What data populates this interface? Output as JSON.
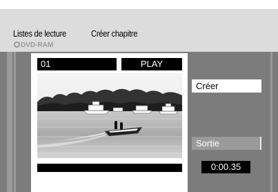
{
  "header": {
    "playlists_label": "Listes de lecture",
    "create_chapter_label": "Créer chapitre",
    "media_label": "DVD-RAM"
  },
  "player": {
    "title_number": "01",
    "status": "PLAY",
    "timecode": "0:00.35",
    "scene": "motorboat-on-lake-photo"
  },
  "actions": {
    "create_label": "Créer",
    "exit_label": "Sortie"
  },
  "colors": {
    "background": "#7c7c7c",
    "header": "#dcdcdc",
    "rail": "#9a9a9a",
    "highlight": "#ffffff"
  }
}
